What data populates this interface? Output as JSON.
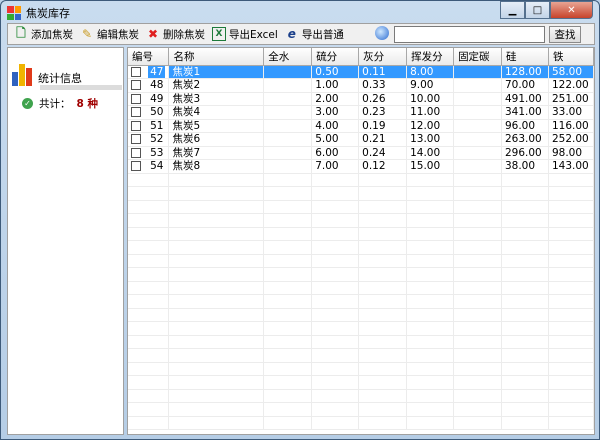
{
  "window": {
    "title": "焦炭库存",
    "controls": [
      "minimize",
      "maximize",
      "close"
    ]
  },
  "toolbar": {
    "items": [
      {
        "label": "添加焦炭",
        "icon": "add-document-icon"
      },
      {
        "label": "编辑焦炭",
        "icon": "edit-icon"
      },
      {
        "label": "删除焦炭",
        "icon": "delete-x-icon"
      },
      {
        "label": "导出Excel",
        "icon": "excel-icon"
      },
      {
        "label": "导出普通",
        "icon": "ie-icon"
      }
    ],
    "search_value": "",
    "find_label": "查找"
  },
  "sidebar": {
    "stat_label": "统计信息",
    "total_label": "共计：",
    "total_value": "8 种"
  },
  "table": {
    "columns": [
      "编号",
      "名称",
      "全水",
      "硫分",
      "灰分",
      "挥发分",
      "固定碳",
      "硅",
      "铁"
    ],
    "rows": [
      [
        "47",
        "焦炭1",
        "",
        "0.50",
        "0.11",
        "8.00",
        "",
        "128.00",
        "58.00"
      ],
      [
        "48",
        "焦炭2",
        "",
        "1.00",
        "0.33",
        "9.00",
        "",
        "70.00",
        "122.00"
      ],
      [
        "49",
        "焦炭3",
        "",
        "2.00",
        "0.26",
        "10.00",
        "",
        "491.00",
        "251.00"
      ],
      [
        "50",
        "焦炭4",
        "",
        "3.00",
        "0.23",
        "11.00",
        "",
        "341.00",
        "33.00"
      ],
      [
        "51",
        "焦炭5",
        "",
        "4.00",
        "0.19",
        "12.00",
        "",
        "96.00",
        "116.00"
      ],
      [
        "52",
        "焦炭6",
        "",
        "5.00",
        "0.21",
        "13.00",
        "",
        "263.00",
        "252.00"
      ],
      [
        "53",
        "焦炭7",
        "",
        "6.00",
        "0.24",
        "14.00",
        "",
        "296.00",
        "98.00"
      ],
      [
        "54",
        "焦炭8",
        "",
        "7.00",
        "0.12",
        "15.00",
        "",
        "38.00",
        "143.00"
      ]
    ],
    "selected_row": 0
  },
  "colors": {
    "selection": "#3399ff",
    "count": "#a00000"
  }
}
